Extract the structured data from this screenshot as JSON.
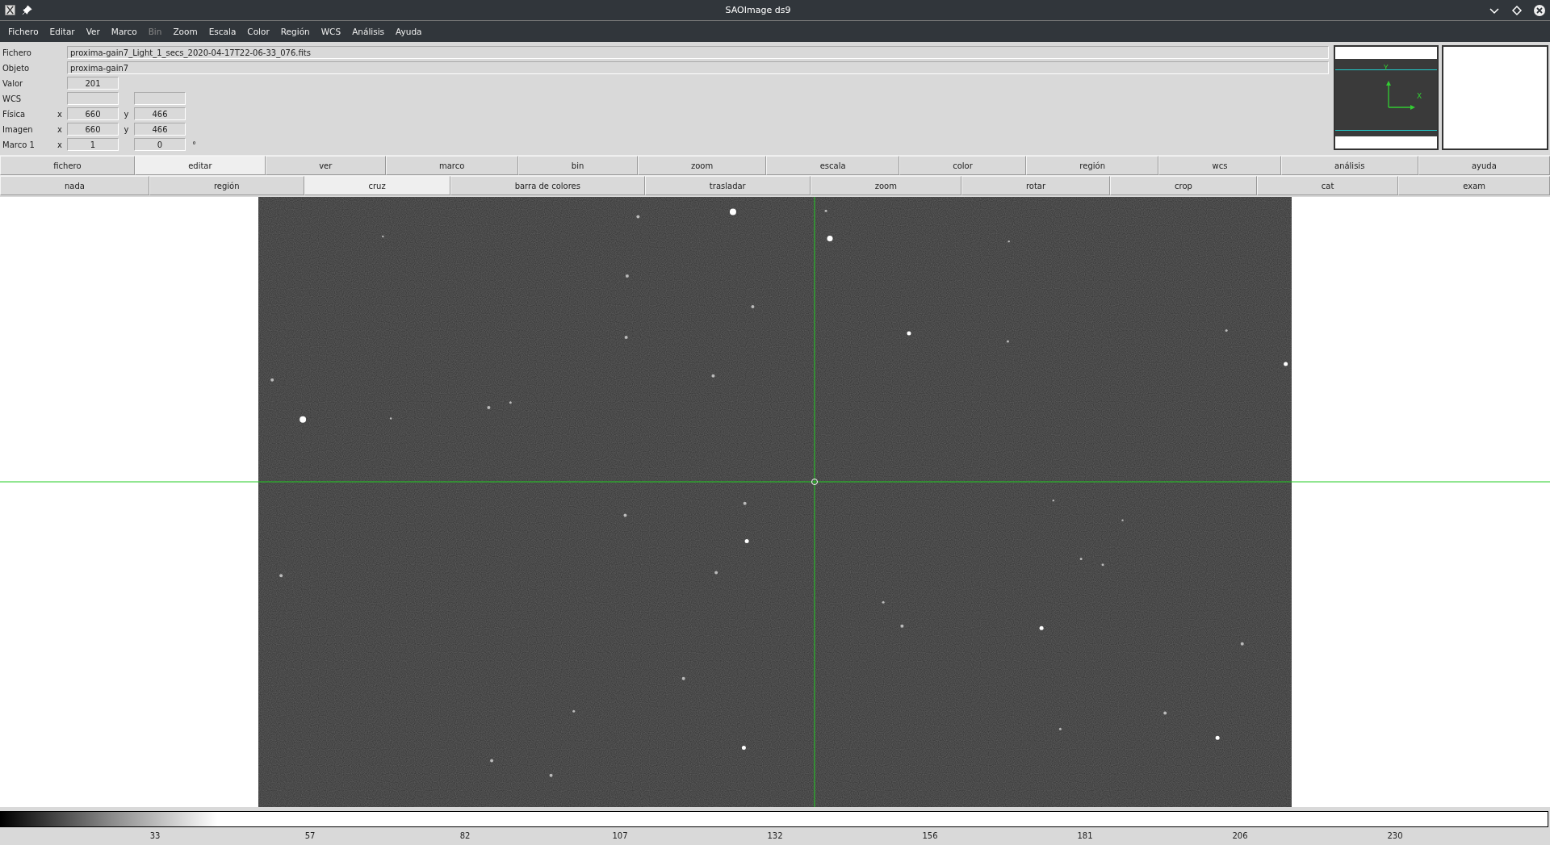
{
  "window": {
    "title": "SAOImage ds9"
  },
  "menu": [
    {
      "label": "Fichero",
      "disabled": false
    },
    {
      "label": "Editar",
      "disabled": false
    },
    {
      "label": "Ver",
      "disabled": false
    },
    {
      "label": "Marco",
      "disabled": false
    },
    {
      "label": "Bin",
      "disabled": true
    },
    {
      "label": "Zoom",
      "disabled": false
    },
    {
      "label": "Escala",
      "disabled": false
    },
    {
      "label": "Color",
      "disabled": false
    },
    {
      "label": "Región",
      "disabled": false
    },
    {
      "label": "WCS",
      "disabled": false
    },
    {
      "label": "Análisis",
      "disabled": false
    },
    {
      "label": "Ayuda",
      "disabled": false
    }
  ],
  "info": [
    {
      "kind": "wide",
      "label": "Fichero",
      "value": "proxima-gain7_Light_1_secs_2020-04-17T22-06-33_076.fits"
    },
    {
      "kind": "wide",
      "label": "Objeto",
      "value": "proxima-gain7"
    },
    {
      "kind": "single",
      "label": "Valor",
      "value": "201"
    },
    {
      "kind": "pair",
      "label": "WCS"
    },
    {
      "kind": "pair",
      "label": "Física",
      "x_label": "x",
      "value": "660",
      "y_label": "y",
      "value2": "466"
    },
    {
      "kind": "pair",
      "label": "Imagen",
      "x_label": "x",
      "value": "660",
      "y_label": "y",
      "value2": "466"
    },
    {
      "kind": "pair",
      "label": "Marco 1",
      "x_label": "x",
      "value": "1",
      "value2": "0",
      "unit": "°"
    }
  ],
  "panner": {
    "x_label": "X",
    "y_label": "Y"
  },
  "button_bar": [
    {
      "label": "fichero",
      "selected": false
    },
    {
      "label": "editar",
      "selected": true
    },
    {
      "label": "ver",
      "selected": false
    },
    {
      "label": "marco",
      "selected": false
    },
    {
      "label": "bin",
      "selected": false
    },
    {
      "label": "zoom",
      "selected": false
    },
    {
      "label": "escala",
      "selected": false
    },
    {
      "label": "color",
      "selected": false
    },
    {
      "label": "región",
      "selected": false
    },
    {
      "label": "wcs",
      "selected": false
    },
    {
      "label": "análisis",
      "selected": false
    },
    {
      "label": "ayuda",
      "selected": false
    }
  ],
  "mode_bar": [
    {
      "label": "nada",
      "selected": false
    },
    {
      "label": "región",
      "selected": false
    },
    {
      "label": "cruz",
      "selected": true
    },
    {
      "label": "barra de colores",
      "selected": false
    },
    {
      "label": "trasladar",
      "selected": false
    },
    {
      "label": "zoom",
      "selected": false
    },
    {
      "label": "rotar",
      "selected": false
    },
    {
      "label": "crop",
      "selected": false
    },
    {
      "label": "cat",
      "selected": false
    },
    {
      "label": "exam",
      "selected": false
    }
  ],
  "colorbar": {
    "ticks": [
      "33",
      "57",
      "82",
      "107",
      "132",
      "156",
      "181",
      "206",
      "230"
    ]
  }
}
